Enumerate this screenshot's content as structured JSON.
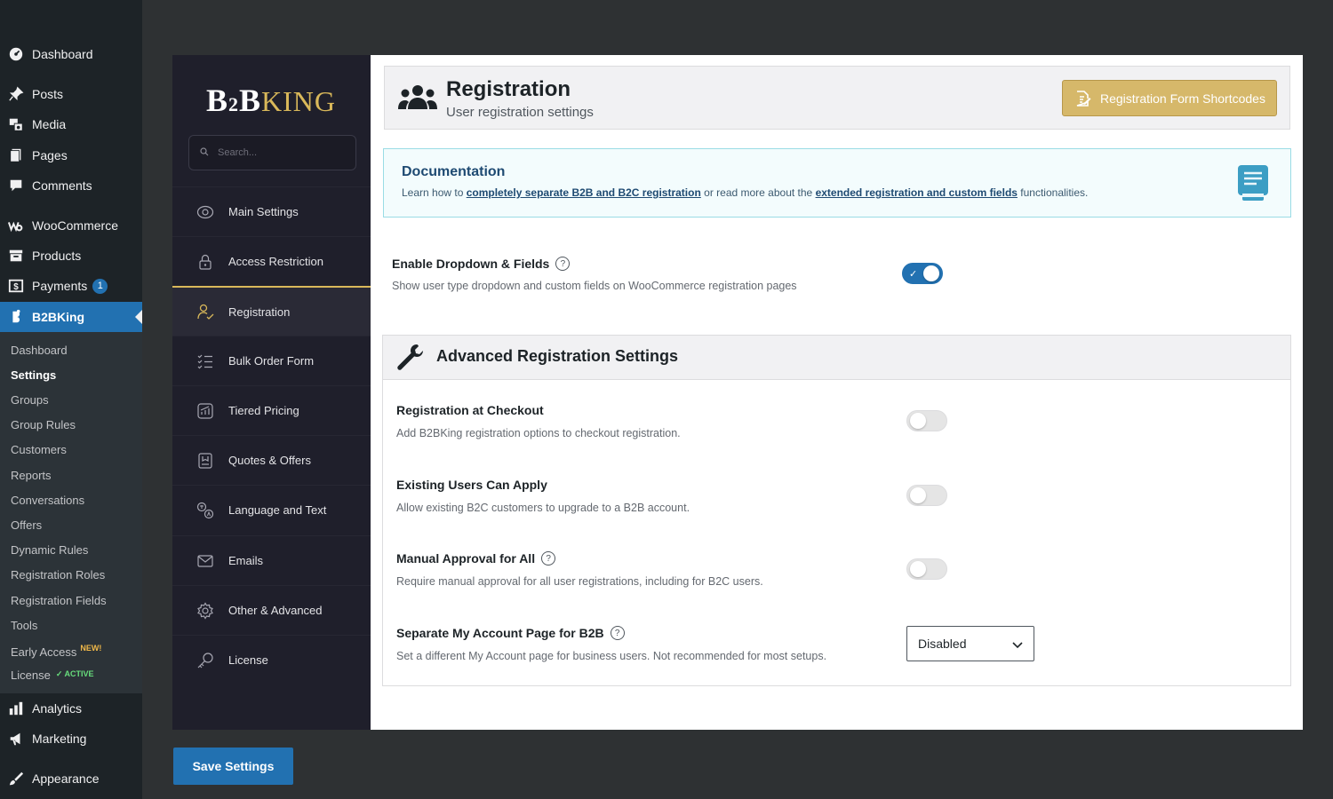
{
  "wp_menu": {
    "items": [
      {
        "label": "Dashboard",
        "icon": "dashboard-icon"
      },
      {
        "label": "Posts",
        "icon": "pin-icon"
      },
      {
        "label": "Media",
        "icon": "media-icon"
      },
      {
        "label": "Pages",
        "icon": "pages-icon"
      },
      {
        "label": "Comments",
        "icon": "comment-icon"
      },
      {
        "label": "WooCommerce",
        "icon": "woocommerce-icon"
      },
      {
        "label": "Products",
        "icon": "archive-icon"
      },
      {
        "label": "Payments",
        "icon": "payments-icon",
        "badge": "1"
      },
      {
        "label": "B2BKing",
        "icon": "b2bking-icon"
      },
      {
        "label": "Analytics",
        "icon": "chart-icon"
      },
      {
        "label": "Marketing",
        "icon": "megaphone-icon"
      },
      {
        "label": "Appearance",
        "icon": "brush-icon"
      }
    ],
    "submenu": [
      {
        "label": "Dashboard"
      },
      {
        "label": "Settings"
      },
      {
        "label": "Groups"
      },
      {
        "label": "Group Rules"
      },
      {
        "label": "Customers"
      },
      {
        "label": "Reports"
      },
      {
        "label": "Conversations"
      },
      {
        "label": "Offers"
      },
      {
        "label": "Dynamic Rules"
      },
      {
        "label": "Registration Roles"
      },
      {
        "label": "Registration Fields"
      },
      {
        "label": "Tools"
      },
      {
        "label": "Early Access",
        "tag": "NEW!"
      },
      {
        "label": "License",
        "tag": "✓ ACTIVE"
      }
    ]
  },
  "plugin_nav": {
    "logo_b2b": "B",
    "logo_two": "2",
    "logo_b": "B",
    "logo_king": "KING",
    "search_placeholder": "Search...",
    "items": [
      {
        "label": "Main Settings",
        "icon": "eye-icon"
      },
      {
        "label": "Access Restriction",
        "icon": "lock-icon"
      },
      {
        "label": "Registration",
        "icon": "user-check-icon"
      },
      {
        "label": "Bulk Order Form",
        "icon": "list-icon"
      },
      {
        "label": "Tiered Pricing",
        "icon": "chart-icon"
      },
      {
        "label": "Quotes & Offers",
        "icon": "receipt-icon"
      },
      {
        "label": "Language and Text",
        "icon": "translate-icon"
      },
      {
        "label": "Emails",
        "icon": "envelope-icon"
      },
      {
        "label": "Other & Advanced",
        "icon": "gear-icon"
      },
      {
        "label": "License",
        "icon": "key-icon"
      }
    ]
  },
  "header": {
    "title": "Registration",
    "subtitle": "User registration settings",
    "button_label": "Registration Form Shortcodes"
  },
  "documentation": {
    "title": "Documentation",
    "text_1": "Learn how to ",
    "link_1": "completely separate B2B and B2C registration",
    "text_2": " or read more about the ",
    "link_2": "extended registration and custom fields",
    "text_3": " functionalities."
  },
  "enable_dropdown": {
    "title": "Enable Dropdown & Fields",
    "help": "?",
    "description": "Show user type dropdown and custom fields on WooCommerce registration pages",
    "enabled": true
  },
  "advanced": {
    "title": "Advanced Registration Settings",
    "settings": [
      {
        "title": "Registration at Checkout",
        "description": "Add B2BKing registration options to checkout registration.",
        "enabled": false
      },
      {
        "title": "Existing Users Can Apply",
        "description": "Allow existing B2C customers to upgrade to a B2B account.",
        "enabled": false
      },
      {
        "title": "Manual Approval for All",
        "description": "Require manual approval for all user registrations, including for B2C users.",
        "enabled": false,
        "help": "?"
      },
      {
        "title": "Separate My Account Page for B2B",
        "description": "Set a different My Account page for business users. Not recommended for most setups.",
        "help": "?",
        "select_value": "Disabled"
      }
    ]
  },
  "save_label": "Save Settings",
  "colors": {
    "wp_sidebar": "#1d2327",
    "accent_blue": "#2271b1",
    "gold": "#d6b86a",
    "plugin_sidebar": "#1f1f2b"
  }
}
